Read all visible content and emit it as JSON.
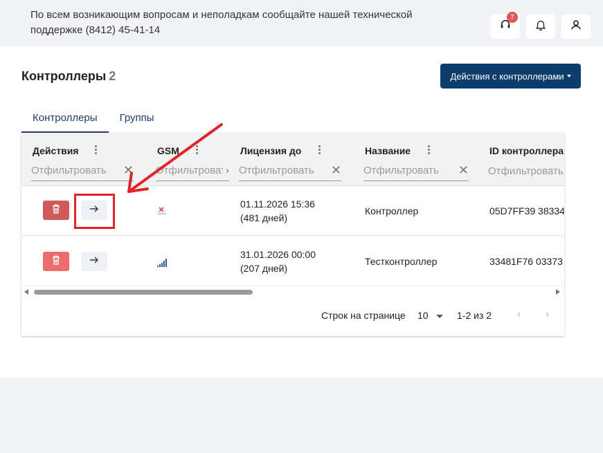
{
  "header": {
    "support_text": "По всем возникающим вопросам и неполадкам сообщайте нашей технической поддержке (8412) 45-41-14",
    "support_badge": "7",
    "icons": [
      "support-headset-icon",
      "bell-icon",
      "user-icon"
    ]
  },
  "page": {
    "title": "Контроллеры",
    "count": "2",
    "actions_button": "Действия с контроллерами"
  },
  "tabs": [
    {
      "label": "Контроллеры",
      "active": true
    },
    {
      "label": "Группы",
      "active": false
    }
  ],
  "table": {
    "columns": [
      {
        "label": "Действия",
        "filter_placeholder": "Отфильтровать"
      },
      {
        "label": "GSM",
        "filter_placeholder": "Отфильтровать"
      },
      {
        "label": "Лицензия до",
        "filter_placeholder": "Отфильтровать"
      },
      {
        "label": "Название",
        "filter_placeholder": "Отфильтровать"
      },
      {
        "label": "ID контроллера",
        "filter_placeholder": "Отфильтровать"
      }
    ],
    "rows": [
      {
        "gsm": "no-signal",
        "license_date": "01.11.2026 15:36",
        "license_days": "(481 дней)",
        "name": "Контроллер",
        "id": "05D7FF39 38334"
      },
      {
        "gsm": "signal",
        "license_date": "31.01.2026 00:00",
        "license_days": "(207 дней)",
        "name": "Тестконтроллер",
        "id": "33481F76 03373"
      }
    ]
  },
  "pagination": {
    "rows_per_page_label": "Строк на странице",
    "rows_per_page": "10",
    "range": "1-2 из 2"
  },
  "colors": {
    "primary": "#0d3d6b",
    "delete": "#ea6c6c",
    "annotation": "#e0232b"
  }
}
